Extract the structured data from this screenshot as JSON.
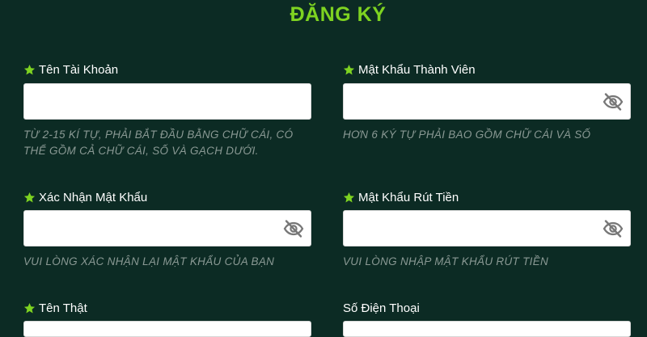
{
  "header": {
    "title": "ĐĂNG KÝ"
  },
  "colors": {
    "background": "#0c2b24",
    "accent": "#7ed321",
    "hint": "#8a9994"
  },
  "icons": {
    "required": "star-icon",
    "toggle_password": "eye-slash-icon"
  },
  "fields": {
    "username": {
      "label": "Tên Tài Khoản",
      "value": "",
      "hint": "TỪ 2-15 KÍ TỰ, PHẢI BẮT ĐẦU BẰNG CHỮ CÁI, CÓ THỂ GỒM CẢ CHỮ CÁI, SỐ VÀ GẠCH DƯỚI."
    },
    "password": {
      "label": "Mật Khẩu Thành Viên",
      "value": "",
      "hint": "HƠN 6 KÝ TỰ PHẢI BAO GỒM CHỮ CÁI VÀ SỐ"
    },
    "confirm_password": {
      "label": "Xác Nhận Mật Khẩu",
      "value": "",
      "hint": "VUI LÒNG XÁC NHẬN LẠI MẬT KHẨU CỦA BẠN"
    },
    "withdraw_password": {
      "label": "Mật Khẩu Rút Tiền",
      "value": "",
      "hint": "VUI LÒNG NHẬP MẬT KHẨU RÚT TIỀN"
    },
    "real_name": {
      "label": "Tên Thật",
      "value": ""
    },
    "phone": {
      "label": "Số Điện Thoại",
      "value": ""
    }
  }
}
